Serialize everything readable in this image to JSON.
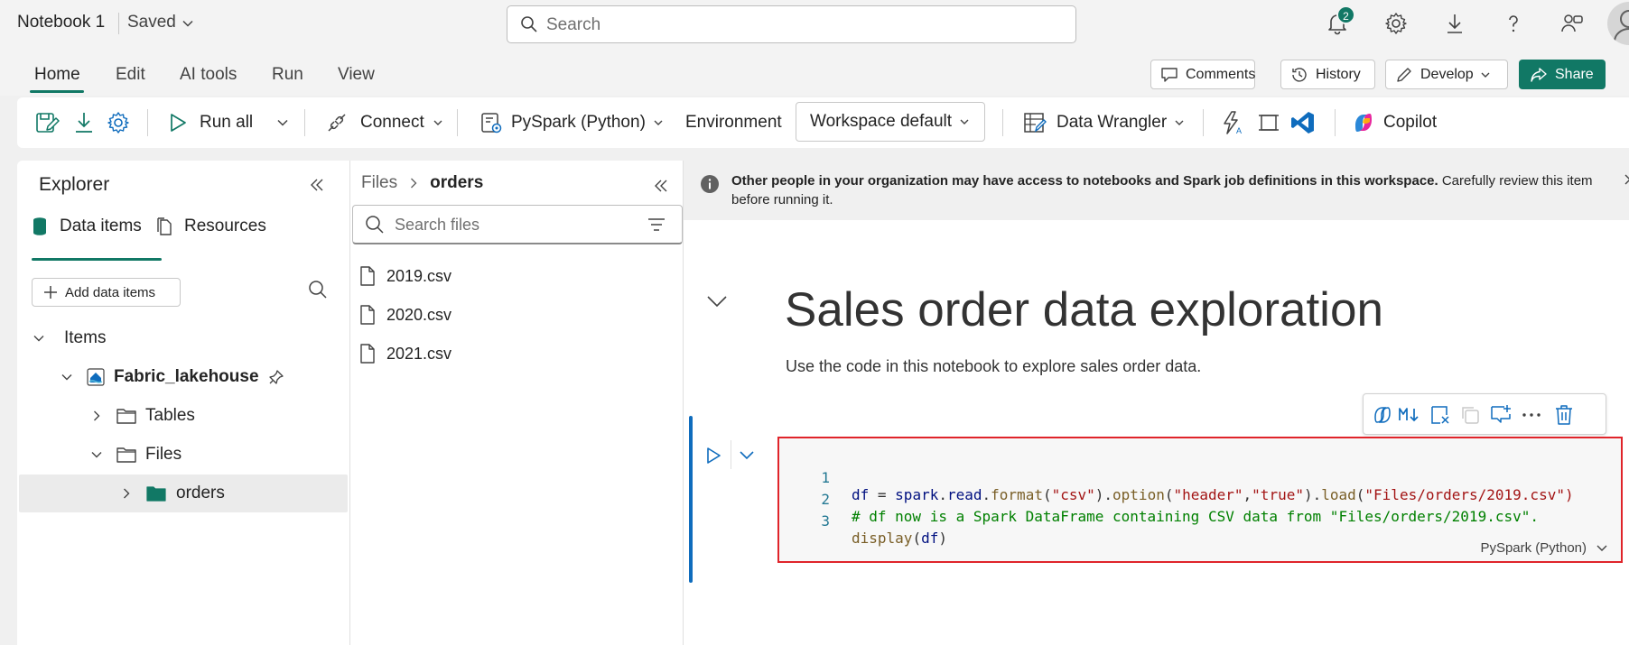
{
  "header": {
    "notebook_title": "Notebook 1",
    "save_status": "Saved",
    "search_placeholder": "Search",
    "notification_count": "2"
  },
  "ribbon_tabs": [
    "Home",
    "Edit",
    "AI tools",
    "Run",
    "View"
  ],
  "ribbon_actions": {
    "comments": "Comments",
    "history": "History",
    "develop": "Develop",
    "share": "Share"
  },
  "toolbar": {
    "run_all": "Run all",
    "connect": "Connect",
    "language": "PySpark (Python)",
    "environment_label": "Environment",
    "environment_value": "Workspace default",
    "data_wrangler": "Data Wrangler",
    "copilot": "Copilot"
  },
  "explorer": {
    "title": "Explorer",
    "tabs": [
      "Data items",
      "Resources"
    ],
    "add_button": "Add data items",
    "tree": {
      "items_label": "Items",
      "lakehouse": "Fabric_lakehouse",
      "tables": "Tables",
      "files": "Files",
      "orders": "orders"
    }
  },
  "files_panel": {
    "breadcrumb_root": "Files",
    "breadcrumb_current": "orders",
    "search_placeholder": "Search files",
    "files": [
      "2019.csv",
      "2020.csv",
      "2021.csv"
    ]
  },
  "notebook": {
    "info_bold": "Other people in your organization may have access to notebooks and Spark job definitions in this workspace.",
    "info_rest": " Carefully review this item before running it.",
    "heading": "Sales order data exploration",
    "description": "Use the code in this notebook to explore sales order data.",
    "code_line_numbers": [
      "1",
      "2",
      "3"
    ],
    "code_language": "PySpark (Python)",
    "code": {
      "l1_a": "df",
      "l1_b": " = ",
      "l1_c": "spark",
      "l1_d": ".",
      "l1_e": "read",
      "l1_f": ".",
      "l1_g": "format",
      "l1_h": "(",
      "l1_i": "\"csv\"",
      "l1_j": ").",
      "l1_k": "option",
      "l1_l": "(",
      "l1_m": "\"header\"",
      "l1_n": ",",
      "l1_o": "\"true\"",
      "l1_p": ").",
      "l1_q": "load",
      "l1_r": "(",
      "l1_s": "\"Files/orders/2019.csv\")",
      "l2": "# df now is a Spark DataFrame containing CSV data from \"Files/orders/2019.csv\".",
      "l3_a": "display",
      "l3_b": "(",
      "l3_c": "df",
      "l3_d": ")"
    }
  },
  "colors": {
    "accent": "#117865",
    "highlight_border": "#e0242a",
    "cell_bar": "#0f6cbd"
  }
}
